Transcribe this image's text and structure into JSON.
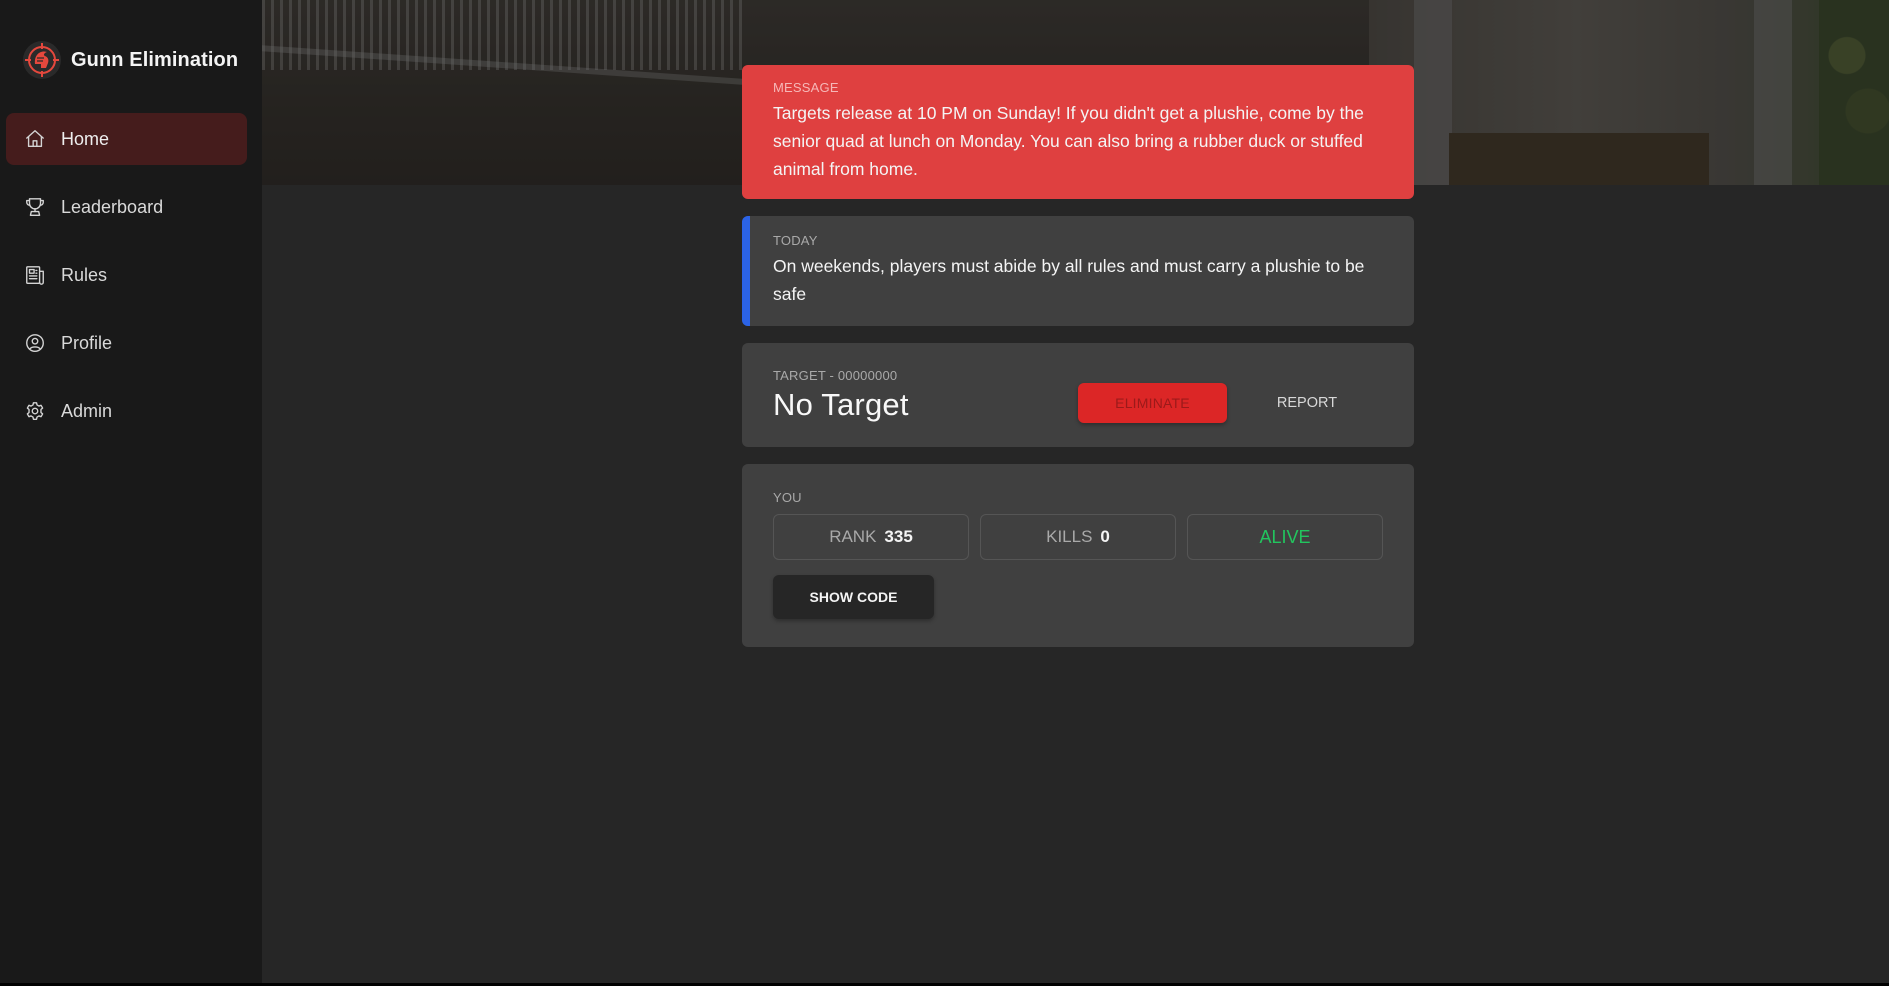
{
  "app": {
    "title": "Gunn Elimination",
    "logo_icon": "spartan-helmet-crosshair-icon"
  },
  "sidebar": {
    "items": [
      {
        "label": "Home",
        "icon": "home-icon",
        "active": true
      },
      {
        "label": "Leaderboard",
        "icon": "trophy-icon",
        "active": false
      },
      {
        "label": "Rules",
        "icon": "newspaper-icon",
        "active": false
      },
      {
        "label": "Profile",
        "icon": "user-circle-icon",
        "active": false
      },
      {
        "label": "Admin",
        "icon": "gear-icon",
        "active": false
      }
    ]
  },
  "message": {
    "label": "MESSAGE",
    "text": "Targets release at 10 PM on Sunday! If you didn't get a plushie, come by the senior quad at lunch on Monday. You can also bring a rubber duck or stuffed animal from home."
  },
  "today": {
    "label": "TODAY",
    "text": "On weekends, players must abide by all rules and must carry a plushie to be safe"
  },
  "target": {
    "label": "TARGET - 00000000",
    "name": "No Target",
    "eliminate_label": "ELIMINATE",
    "report_label": "REPORT"
  },
  "you": {
    "label": "YOU",
    "rank_key": "RANK",
    "rank_value": "335",
    "kills_key": "KILLS",
    "kills_value": "0",
    "status": "ALIVE",
    "show_code_label": "SHOW CODE"
  },
  "colors": {
    "accent_red": "#df4040",
    "eliminate_red": "#dc2626",
    "today_blue": "#2b63e6",
    "alive_green": "#22c55e",
    "active_nav": "#451c1c"
  }
}
